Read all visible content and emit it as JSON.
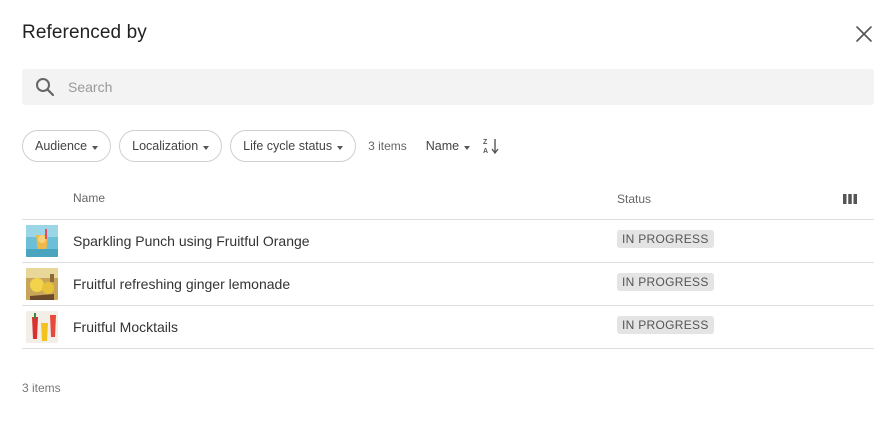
{
  "dialog": {
    "title": "Referenced by",
    "close_icon": "close-icon"
  },
  "search": {
    "placeholder": "Search",
    "value": "",
    "icon": "search-icon"
  },
  "filters": {
    "chips": [
      {
        "label": "Audience"
      },
      {
        "label": "Localization"
      },
      {
        "label": "Life cycle status"
      }
    ],
    "count_label": "3 items",
    "sort_label": "Name",
    "sort_direction_icon": "sort-az-icon"
  },
  "table": {
    "columns": {
      "name": "Name",
      "status": "Status",
      "column_picker_icon": "columns-icon"
    },
    "rows": [
      {
        "name": "Sparkling Punch using Fruitful Orange",
        "status": "IN PROGRESS"
      },
      {
        "name": "Fruitful refreshing ginger lemonade",
        "status": "IN PROGRESS"
      },
      {
        "name": "Fruitful Mocktails",
        "status": "IN PROGRESS"
      }
    ]
  },
  "footer": {
    "count_label": "3 items"
  },
  "colors": {
    "search_bg": "#f3f3f3",
    "badge_bg": "#e4e4e4",
    "divider": "#dedede",
    "chip_border": "#cfcfcf"
  }
}
